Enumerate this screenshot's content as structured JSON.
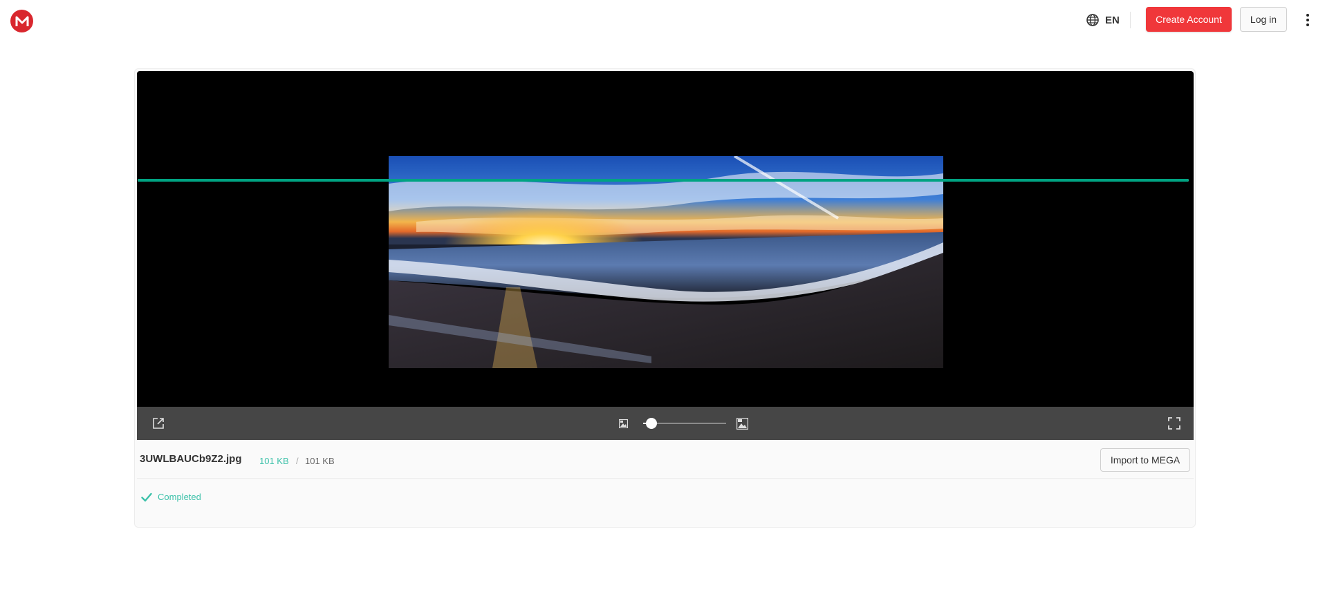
{
  "header": {
    "logo_letter": "M",
    "language": "EN",
    "create_account_label": "Create Account",
    "login_label": "Log in"
  },
  "viewer": {
    "image_alt": "3UWLBAUCb9Z2.jpg",
    "zoom_level": 0.1
  },
  "file": {
    "name": "3UWLBAUCb9Z2.jpg",
    "size_downloaded": "101 KB",
    "size_separator": "/",
    "size_total": "101 KB",
    "import_label": "Import to MEGA"
  },
  "status": {
    "text": "Completed",
    "progress": 1.0
  },
  "colors": {
    "brand": "#d9272e",
    "create_button": "#f0373a",
    "success": "#3cc1a9",
    "progress": "#00a382"
  }
}
